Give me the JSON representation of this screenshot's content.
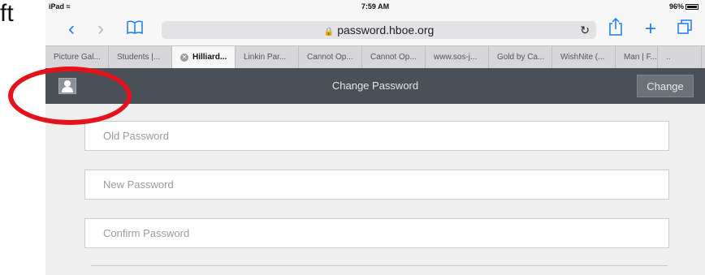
{
  "annotation": {
    "caption": "ft",
    "highlight_color": "#e4121a"
  },
  "status_bar": {
    "device": "iPad",
    "time": "7:59 AM",
    "battery": "96%"
  },
  "browser": {
    "url": "password.hboe.org",
    "back_icon": "chevron-left-icon",
    "forward_icon": "chevron-right-icon",
    "bookmarks_icon": "book-icon",
    "reload_icon": "reload-icon",
    "share_icon": "share-icon",
    "new_tab_icon": "plus-icon",
    "tabs_icon": "tabs-icon",
    "tabs": [
      {
        "label": "Picture Gal..."
      },
      {
        "label": "Students |..."
      },
      {
        "label": "Hilliard...",
        "active": true
      },
      {
        "label": "Linkin Par..."
      },
      {
        "label": "Cannot Op..."
      },
      {
        "label": "Cannot Op..."
      },
      {
        "label": "www.sos-j..."
      },
      {
        "label": "Gold by Ca..."
      },
      {
        "label": "WishNite (..."
      },
      {
        "label": "Man | F..."
      },
      {
        "label": ".."
      }
    ]
  },
  "app": {
    "title": "Change Password",
    "change_button": "Change",
    "user_icon": "user-icon",
    "header_color": "#495057"
  },
  "form": {
    "old_password": {
      "placeholder": "Old Password"
    },
    "new_password": {
      "placeholder": "New Password"
    },
    "confirm_password": {
      "placeholder": "Confirm Password"
    }
  }
}
